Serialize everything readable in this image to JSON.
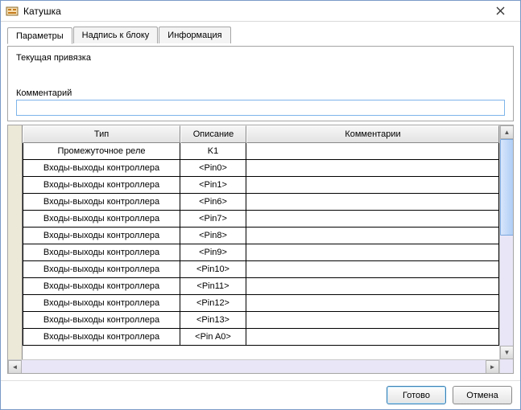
{
  "window": {
    "title": "Катушка"
  },
  "tabs": [
    {
      "label": "Параметры",
      "active": true
    },
    {
      "label": "Надпись к блоку",
      "active": false
    },
    {
      "label": "Информация",
      "active": false
    }
  ],
  "binding": {
    "label": "Текущая привязка",
    "value": ""
  },
  "comment": {
    "label": "Комментарий",
    "value": ""
  },
  "table": {
    "headers": {
      "type": "Тип",
      "desc": "Описание",
      "comm": "Комментарии"
    },
    "rows": [
      {
        "type": "Промежуточное реле",
        "desc": "K1",
        "comm": ""
      },
      {
        "type": "Входы-выходы контроллера",
        "desc": "<Pin0>",
        "comm": ""
      },
      {
        "type": "Входы-выходы контроллера",
        "desc": "<Pin1>",
        "comm": ""
      },
      {
        "type": "Входы-выходы контроллера",
        "desc": "<Pin6>",
        "comm": ""
      },
      {
        "type": "Входы-выходы контроллера",
        "desc": "<Pin7>",
        "comm": ""
      },
      {
        "type": "Входы-выходы контроллера",
        "desc": "<Pin8>",
        "comm": ""
      },
      {
        "type": "Входы-выходы контроллера",
        "desc": "<Pin9>",
        "comm": ""
      },
      {
        "type": "Входы-выходы контроллера",
        "desc": "<Pin10>",
        "comm": ""
      },
      {
        "type": "Входы-выходы контроллера",
        "desc": "<Pin11>",
        "comm": ""
      },
      {
        "type": "Входы-выходы контроллера",
        "desc": "<Pin12>",
        "comm": ""
      },
      {
        "type": "Входы-выходы контроллера",
        "desc": "<Pin13>",
        "comm": ""
      },
      {
        "type": "Входы-выходы контроллера",
        "desc": "<Pin A0>",
        "comm": ""
      }
    ]
  },
  "buttons": {
    "ok": "Готово",
    "cancel": "Отмена"
  }
}
